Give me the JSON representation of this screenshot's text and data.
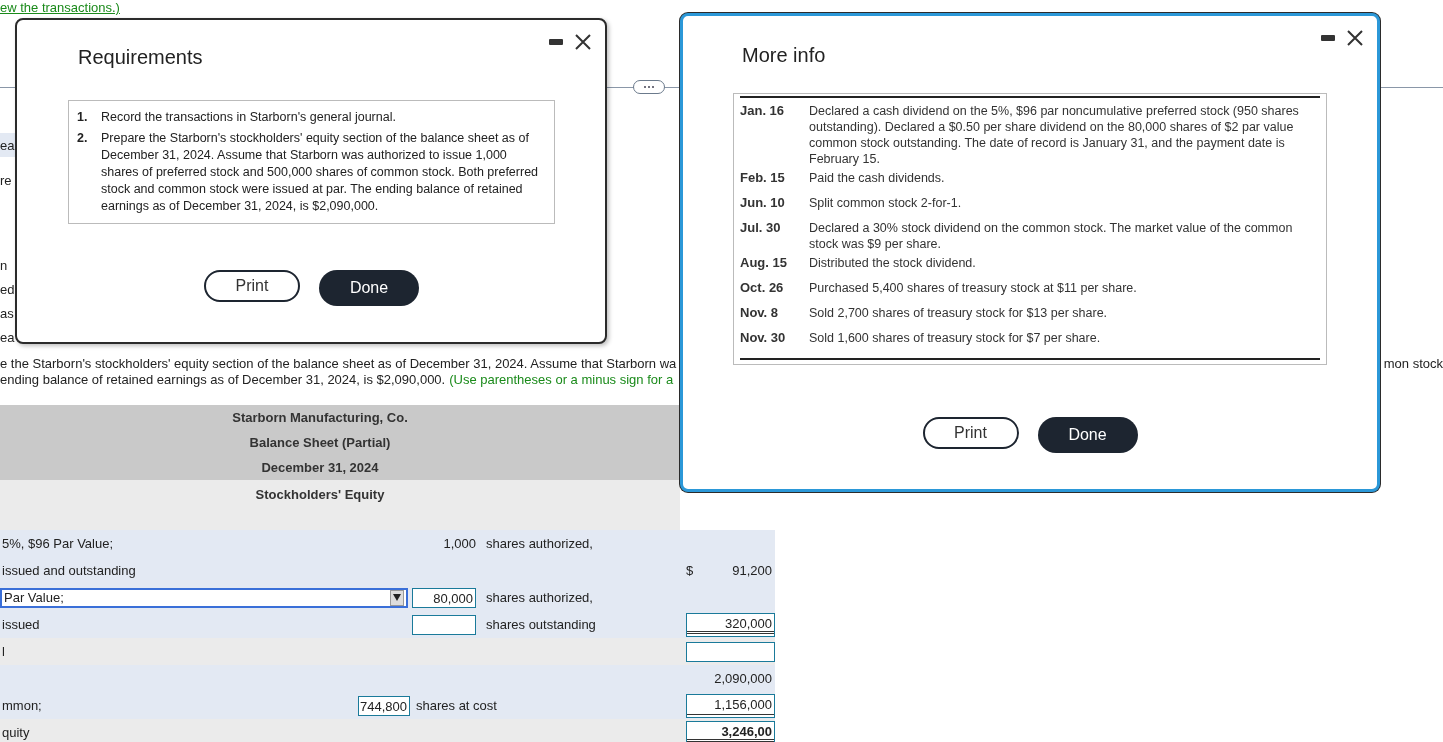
{
  "background": {
    "link": "ew the transactions.)",
    "edge_fragments": [
      {
        "text": "ea",
        "highlighted": true
      },
      {
        "text": "re",
        "highlighted": false
      },
      {
        "text": "n",
        "highlighted": false
      },
      {
        "text": "ed",
        "highlighted": false
      },
      {
        "text": "as",
        "highlighted": false
      },
      {
        "text": "ea",
        "highlighted": false
      }
    ],
    "instructions": {
      "line_1": "e the Starborn's stockholders' equity section of the balance sheet as of December 31, 2024. Assume that Starborn wa",
      "line_2": "ending balance of retained earnings as of December 31, 2024, is $2,090,000.",
      "hint": "(Use parentheses or a minus sign for a"
    },
    "right_fragment": "mon stock",
    "balance_sheet": {
      "heading": [
        "Starborn Manufacturing, Co.",
        "Balance Sheet (Partial)",
        "December 31, 2024"
      ],
      "section": "Stockholders' Equity",
      "rows": [
        {
          "kind": "text",
          "label": "5%, $96 Par Value;",
          "shares": {
            "kind": "text",
            "value": "1,000"
          },
          "shares_text": "shares authorized,"
        },
        {
          "kind": "text",
          "label": "issued and outstanding",
          "currency": "$",
          "amount": {
            "kind": "text",
            "value": "91,200"
          }
        },
        {
          "kind": "select",
          "label": "Par Value;",
          "shares": {
            "kind": "input",
            "value": "80,000"
          },
          "shares_text": "shares authorized,"
        },
        {
          "kind": "text",
          "label": "issued",
          "shares": {
            "kind": "input"
          },
          "shares_text": "shares outstanding",
          "amount": {
            "kind": "input",
            "value": "320,000",
            "underlined": true,
            "double": true
          }
        },
        {
          "kind": "total",
          "label": "l",
          "amount": {
            "kind": "input"
          }
        },
        {
          "kind": "text",
          "amount": {
            "kind": "text",
            "value": "2,090,000"
          }
        },
        {
          "kind": "text",
          "label": "mmon;",
          "shares": {
            "kind": "input_left",
            "value": "744,800"
          },
          "shares_text": "shares at cost",
          "amount": {
            "kind": "input",
            "value": "1,156,000",
            "underlined": true,
            "double": false
          }
        },
        {
          "kind": "total",
          "label": "quity",
          "amount": {
            "kind": "input",
            "value": "3,246,00",
            "underlined": true,
            "double": true,
            "bold": true
          }
        }
      ]
    }
  },
  "requirements_dialog": {
    "title": "Requirements",
    "items": [
      {
        "number": "1.",
        "text": "Record the transactions in Starborn's general journal."
      },
      {
        "number": "2.",
        "text": "Prepare the Starborn's stockholders' equity section of the balance sheet as of December 31, 2024. Assume that Starborn was authorized to issue 1,000 shares of preferred stock and 500,000 shares of common stock. Both preferred stock and common stock were issued at par. The ending balance of retained earnings as of December 31, 2024, is $2,090,000."
      }
    ],
    "buttons": [
      "Print",
      "Done"
    ]
  },
  "more_info_dialog": {
    "title": "More info",
    "transactions": [
      {
        "date": "Jan. 16",
        "text": "Declared a cash dividend on the 5%, $96 par noncumulative preferred stock (950 shares outstanding). Declared a $0.50 per share dividend on the 80,000 shares of $2 par value common stock outstanding. The date of record is January 31, and the payment date is February 15."
      },
      {
        "date": "Feb. 15",
        "text": "Paid the cash dividends."
      },
      {
        "date": "Jun. 10",
        "text": "Split common stock 2-for-1."
      },
      {
        "date": "Jul. 30",
        "text": "Declared a 30% stock dividend on the common stock. The market value of the common stock was $9 per share."
      },
      {
        "date": "Aug. 15",
        "text": "Distributed the stock dividend."
      },
      {
        "date": "Oct. 26",
        "text": "Purchased 5,400 shares of treasury stock at $11 per share."
      },
      {
        "date": "Nov. 8",
        "text": "Sold 2,700 shares of treasury stock for $13 per share."
      },
      {
        "date": "Nov. 30",
        "text": "Sold 1,600 shares of treasury stock for $7 per share."
      }
    ],
    "buttons": [
      "Print",
      "Done"
    ]
  }
}
